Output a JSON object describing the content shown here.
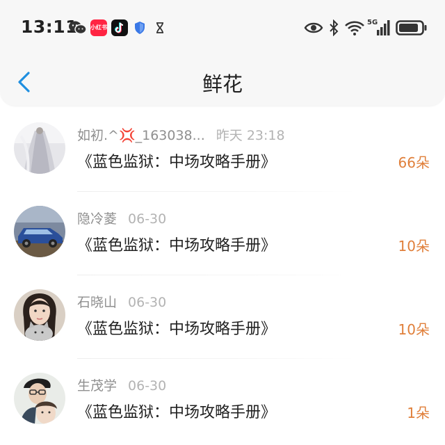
{
  "status_bar": {
    "time": "13:11",
    "xhs_label": "小红书",
    "network": "5G",
    "icons_left": [
      "wechat-icon",
      "xiaohongshu-icon",
      "tiktok-icon",
      "shield-icon",
      "hourglass-icon"
    ],
    "icons_right": [
      "eye-icon",
      "bluetooth-icon",
      "wifi-icon",
      "signal-icon",
      "battery-icon"
    ]
  },
  "header": {
    "title": "鲜花",
    "back_icon": "chevron-left-icon",
    "accent": "#1f8fe0"
  },
  "colors": {
    "count": "#e07f3a",
    "name": "#8f8f8f",
    "time": "#b3b3b3"
  },
  "list": {
    "items": [
      {
        "name": "如初.^💢_163038...",
        "time": "昨天 23:18",
        "book": "《蓝色监狱：中场攻略手册》",
        "count": "66朵",
        "avatar": "avatar-wedding-dress"
      },
      {
        "name": "隐冷菱",
        "time": "06-30",
        "book": "《蓝色监狱：中场攻略手册》",
        "count": "10朵",
        "avatar": "avatar-blue-car"
      },
      {
        "name": "石晓山",
        "time": "06-30",
        "book": "《蓝色监狱：中场攻略手册》",
        "count": "10朵",
        "avatar": "avatar-girl-with-cat"
      },
      {
        "name": "生茂学",
        "time": "06-30",
        "book": "《蓝色监狱：中场攻略手册》",
        "count": "1朵",
        "avatar": "avatar-couple-selfie"
      }
    ]
  }
}
